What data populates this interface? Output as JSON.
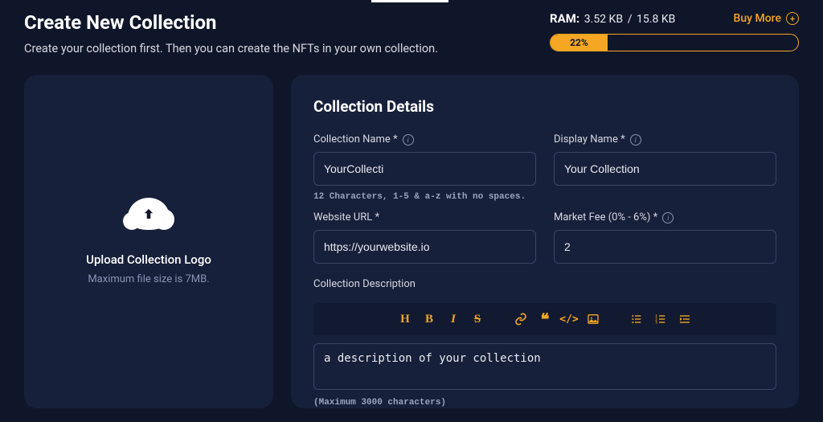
{
  "header": {
    "title": "Create New Collection",
    "subtitle": "Create your collection first. Then you can create the NFTs in your own collection."
  },
  "ram": {
    "label": "RAM:",
    "used": "3.52 KB",
    "total": "15.8 KB",
    "buy_more": "Buy More",
    "percent_label": "22%",
    "percent_width": "23%"
  },
  "upload": {
    "title": "Upload Collection Logo",
    "subtitle": "Maximum file size is 7MB."
  },
  "details": {
    "section_title": "Collection Details",
    "collection_name": {
      "label": "Collection Name *",
      "value": "YourCollecti",
      "helper": "12 Characters, 1-5 & a-z with no spaces."
    },
    "display_name": {
      "label": "Display Name *",
      "value": "Your Collection"
    },
    "website": {
      "label": "Website URL *",
      "value": "https://yourwebsite.io"
    },
    "market_fee": {
      "label": "Market Fee (0% - 6%) *",
      "value": "2"
    },
    "description": {
      "label": "Collection Description",
      "value": "a description of your collection",
      "max": "(Maximum 3000 characters)"
    }
  },
  "toolbar": {
    "heading": "H",
    "bold": "B",
    "italic": "I",
    "strike": "S",
    "link": "link",
    "quote": "quote",
    "code": "code",
    "image": "image",
    "ul": "ul",
    "ol": "ol",
    "outdent": "outdent"
  }
}
